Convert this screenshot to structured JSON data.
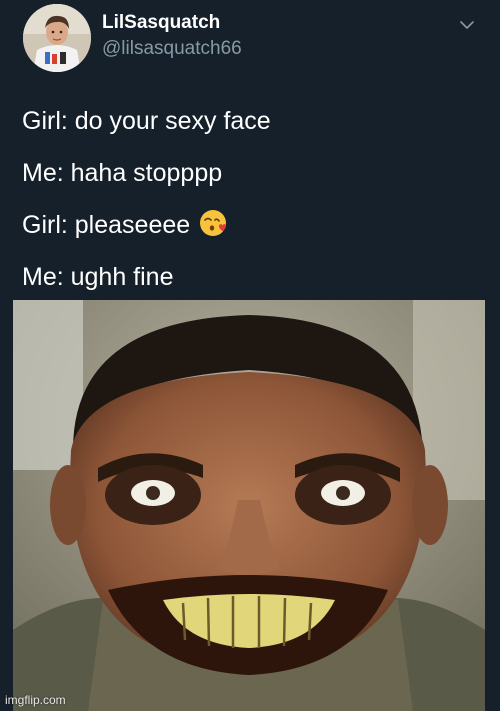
{
  "user": {
    "display_name": "LilSasquatch",
    "handle": "@lilsasquatch66"
  },
  "tweet": {
    "lines": [
      "Girl: do your sexy face",
      "Me: haha stopppp",
      "Girl: pleaseeee",
      "Me: ughh fine"
    ],
    "emoji": "face-throwing-a-kiss-icon"
  },
  "media": {
    "subject": "close-up photo of a man with a wide grinning smile"
  },
  "watermark": "imgflip.com",
  "colors": {
    "background": "#15202b",
    "text": "#ffffff",
    "handle": "#8899a6"
  }
}
